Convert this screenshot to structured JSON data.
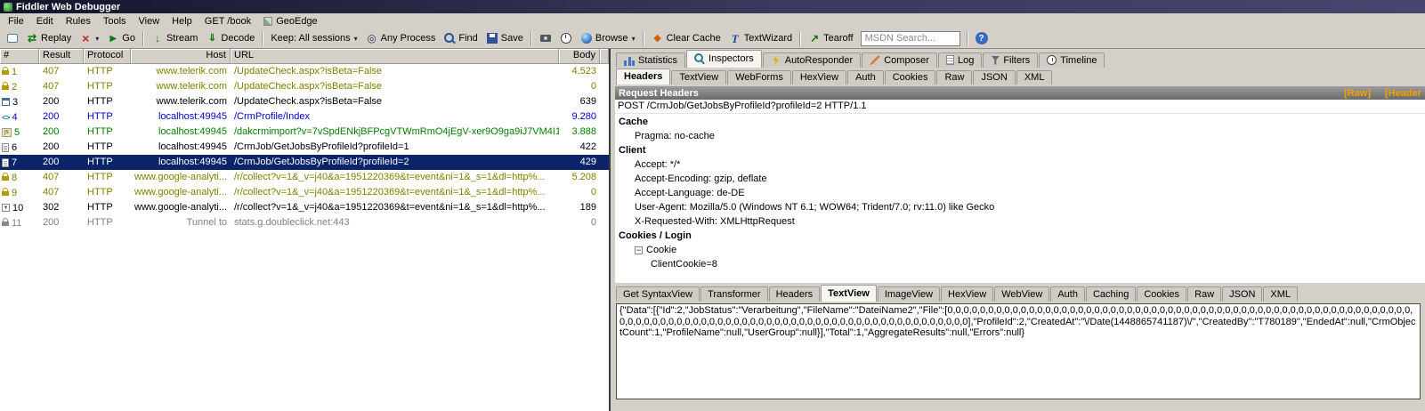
{
  "window": {
    "title": "Fiddler Web Debugger"
  },
  "menu": {
    "items": [
      {
        "label": "File"
      },
      {
        "label": "Edit"
      },
      {
        "label": "Rules"
      },
      {
        "label": "Tools"
      },
      {
        "label": "View"
      },
      {
        "label": "Help"
      },
      {
        "label": "GET /book"
      },
      {
        "label": "GeoEdge",
        "icon": "geoedge-icon"
      }
    ]
  },
  "toolbar": {
    "items": [
      {
        "type": "icon",
        "icon": "comment-icon",
        "name": "add-comment-button"
      },
      {
        "type": "button",
        "icon": "replay-icon",
        "label": "Replay",
        "name": "replay-button"
      },
      {
        "type": "button",
        "icon": "delete-icon",
        "label": "",
        "dropdown": true,
        "name": "remove-sessions-button"
      },
      {
        "type": "button",
        "icon": "go-icon",
        "label": "Go",
        "name": "go-button"
      },
      {
        "type": "sep"
      },
      {
        "type": "button",
        "icon": "stream-icon",
        "label": "Stream",
        "name": "stream-button"
      },
      {
        "type": "button",
        "icon": "decode-icon",
        "label": "Decode",
        "name": "decode-button"
      },
      {
        "type": "sep"
      },
      {
        "type": "button",
        "label": "Keep: All sessions",
        "dropdown": true,
        "name": "keep-sessions-button"
      },
      {
        "type": "button",
        "icon": "process-icon",
        "label": "Any Process",
        "name": "any-process-button"
      },
      {
        "type": "button",
        "icon": "find-icon",
        "label": "Find",
        "name": "find-button"
      },
      {
        "type": "button",
        "icon": "save-icon",
        "label": "Save",
        "name": "save-button"
      },
      {
        "type": "sep"
      },
      {
        "type": "icon",
        "icon": "camera-icon",
        "name": "screenshot-button"
      },
      {
        "type": "icon",
        "icon": "timer-icon",
        "name": "timer-button"
      },
      {
        "type": "button",
        "icon": "browse-icon",
        "label": "Browse",
        "dropdown": true,
        "name": "browse-button"
      },
      {
        "type": "sep"
      },
      {
        "type": "button",
        "icon": "clearcache-icon",
        "label": "Clear Cache",
        "name": "clear-cache-button"
      },
      {
        "type": "button",
        "icon": "textwizard-icon",
        "label": "TextWizard",
        "name": "textwizard-button"
      },
      {
        "type": "sep"
      },
      {
        "type": "button",
        "icon": "tearoff-icon",
        "label": "Tearoff",
        "name": "tearoff-button"
      },
      {
        "type": "search",
        "placeholder": "MSDN Search...",
        "name": "msdn-search-input"
      },
      {
        "type": "sep"
      },
      {
        "type": "icon",
        "icon": "help-icon",
        "name": "help-button"
      }
    ]
  },
  "sessions": {
    "columns": [
      {
        "key": "num",
        "label": "#"
      },
      {
        "key": "result",
        "label": "Result"
      },
      {
        "key": "protocol",
        "label": "Protocol"
      },
      {
        "key": "host",
        "label": "Host"
      },
      {
        "key": "url",
        "label": "URL"
      },
      {
        "key": "body",
        "label": "Body"
      }
    ],
    "rows": [
      {
        "num": "1",
        "icon": "key-icon",
        "result": "407",
        "protocol": "HTTP",
        "host": "www.telerik.com",
        "url": "/UpdateCheck.aspx?isBeta=False",
        "body": "4.523",
        "color": "olive",
        "selected": false
      },
      {
        "num": "2",
        "icon": "key-icon",
        "result": "407",
        "protocol": "HTTP",
        "host": "www.telerik.com",
        "url": "/UpdateCheck.aspx?isBeta=False",
        "body": "0",
        "color": "olive",
        "selected": false
      },
      {
        "num": "3",
        "icon": "window-icon",
        "result": "200",
        "protocol": "HTTP",
        "host": "www.telerik.com",
        "url": "/UpdateCheck.aspx?isBeta=False",
        "body": "639",
        "color": "black",
        "selected": false
      },
      {
        "num": "4",
        "icon": "code-icon",
        "result": "200",
        "protocol": "HTTP",
        "host": "localhost:49945",
        "url": "/CrmProfile/Index",
        "body": "9.280",
        "color": "blue",
        "selected": false
      },
      {
        "num": "5",
        "icon": "js-icon",
        "result": "200",
        "protocol": "HTTP",
        "host": "localhost:49945",
        "url": "/dakcrmimport?v=7vSpdENkjBFPcgVTWmRmO4jEgV-xer9O9ga9iJ7VM4I1",
        "body": "3.888",
        "color": "green",
        "selected": false
      },
      {
        "num": "6",
        "icon": "page-icon",
        "result": "200",
        "protocol": "HTTP",
        "host": "localhost:49945",
        "url": "/CrmJob/GetJobsByProfileId?profileId=1",
        "body": "422",
        "color": "black",
        "selected": false
      },
      {
        "num": "7",
        "icon": "page-icon",
        "result": "200",
        "protocol": "HTTP",
        "host": "localhost:49945",
        "url": "/CrmJob/GetJobsByProfileId?profileId=2",
        "body": "429",
        "color": "black",
        "selected": true
      },
      {
        "num": "8",
        "icon": "key-icon",
        "result": "407",
        "protocol": "HTTP",
        "host": "www.google-analyti...",
        "url": "/r/collect?v=1&_v=j40&a=1951220369&t=event&ni=1&_s=1&dl=http%...",
        "body": "5.208",
        "color": "olive",
        "selected": false
      },
      {
        "num": "9",
        "icon": "key-icon",
        "result": "407",
        "protocol": "HTTP",
        "host": "www.google-analyti...",
        "url": "/r/collect?v=1&_v=j40&a=1951220369&t=event&ni=1&_s=1&dl=http%...",
        "body": "0",
        "color": "olive",
        "selected": false
      },
      {
        "num": "10",
        "icon": "redirect-icon",
        "result": "302",
        "protocol": "HTTP",
        "host": "www.google-analyti...",
        "url": "/r/collect?v=1&_v=j40&a=1951220369&t=event&ni=1&_s=1&dl=http%...",
        "body": "189",
        "color": "black",
        "selected": false
      },
      {
        "num": "11",
        "icon": "lock-icon",
        "result": "200",
        "protocol": "HTTP",
        "host": "Tunnel to",
        "url": "stats.g.doubleclick.net:443",
        "body": "0",
        "color": "gray",
        "selected": false
      }
    ]
  },
  "inspector": {
    "top_tabs": [
      {
        "label": "Statistics",
        "icon": "statistics-icon",
        "active": false
      },
      {
        "label": "Inspectors",
        "icon": "inspectors-icon",
        "active": true
      },
      {
        "label": "AutoResponder",
        "icon": "autoresponder-icon",
        "active": false
      },
      {
        "label": "Composer",
        "icon": "composer-icon",
        "active": false
      },
      {
        "label": "Log",
        "icon": "log-icon",
        "active": false
      },
      {
        "label": "Filters",
        "icon": "filters-icon",
        "active": false
      },
      {
        "label": "Timeline",
        "icon": "timeline-icon",
        "active": false
      }
    ],
    "request_tabs": [
      {
        "label": "Headers",
        "active": true
      },
      {
        "label": "TextView",
        "active": false
      },
      {
        "label": "WebForms",
        "active": false
      },
      {
        "label": "HexView",
        "active": false
      },
      {
        "label": "Auth",
        "active": false
      },
      {
        "label": "Cookies",
        "active": false
      },
      {
        "label": "Raw",
        "active": false
      },
      {
        "label": "JSON",
        "active": false
      },
      {
        "label": "XML",
        "active": false
      }
    ],
    "request_headers_title": "Request Headers",
    "raw_link": "[Raw]",
    "header_link": "[Header",
    "request_line": "POST /CrmJob/GetJobsByProfileId?profileId=2 HTTP/1.1",
    "tree": [
      {
        "name": "Cache",
        "items": [
          {
            "text": "Pragma: no-cache"
          }
        ]
      },
      {
        "name": "Client",
        "items": [
          {
            "text": "Accept: */*"
          },
          {
            "text": "Accept-Encoding: gzip, deflate"
          },
          {
            "text": "Accept-Language: de-DE"
          },
          {
            "text": "User-Agent: Mozilla/5.0 (Windows NT 6.1; WOW64; Trident/7.0; rv:11.0) like Gecko"
          },
          {
            "text": "X-Requested-With: XMLHttpRequest"
          }
        ]
      },
      {
        "name": "Cookies / Login",
        "items": [
          {
            "text": "Cookie",
            "expander": true
          },
          {
            "text": "ClientCookie=8",
            "indent": 2
          }
        ]
      }
    ],
    "response_tabs": [
      {
        "label": "Get SyntaxView",
        "active": false
      },
      {
        "label": "Transformer",
        "active": false
      },
      {
        "label": "Headers",
        "active": false
      },
      {
        "label": "TextView",
        "active": true
      },
      {
        "label": "ImageView",
        "active": false
      },
      {
        "label": "HexView",
        "active": false
      },
      {
        "label": "WebView",
        "active": false
      },
      {
        "label": "Auth",
        "active": false
      },
      {
        "label": "Caching",
        "active": false
      },
      {
        "label": "Cookies",
        "active": false
      },
      {
        "label": "Raw",
        "active": false
      },
      {
        "label": "JSON",
        "active": false
      },
      {
        "label": "XML",
        "active": false
      }
    ],
    "response_body": "{\"Data\":[{\"Id\":2,\"JobStatus\":\"Verarbeitung\",\"FileName\":\"DateiName2\",\"File\":[0,0,0,0,0,0,0,0,0,0,0,0,0,0,0,0,0,0,0,0,0,0,0,0,0,0,0,0,0,0,0,0,0,0,0,0,0,0,0,0,0,0,0,0,0,0,0,0,0,0,0,0,0,0,0,0,0,0,0,0,0,0,0,0,0,0,0,0,0,0,0,0,0,0,0,0,0,0,0,0,0,0,0,0,0,0,0,0,0,0,0,0,0,0,0,0,0,0,0,0],\"ProfileId\":2,\"CreatedAt\":\"\\/Date(1448865741187)\\/\",\"CreatedBy\":\"T780189\",\"EndedAt\":null,\"CrmObjectCount\":1,\"ProfileName\":null,\"UserGroup\":null}],\"Total\":1,\"AggregateResults\":null,\"Errors\":null}"
  },
  "colors": {
    "selection_bg": "#0a246a",
    "link_orange": "#f0a000",
    "result_auth": "#808000",
    "result_redirect_blue": "#0000cc",
    "tunnel_gray": "#808080"
  }
}
